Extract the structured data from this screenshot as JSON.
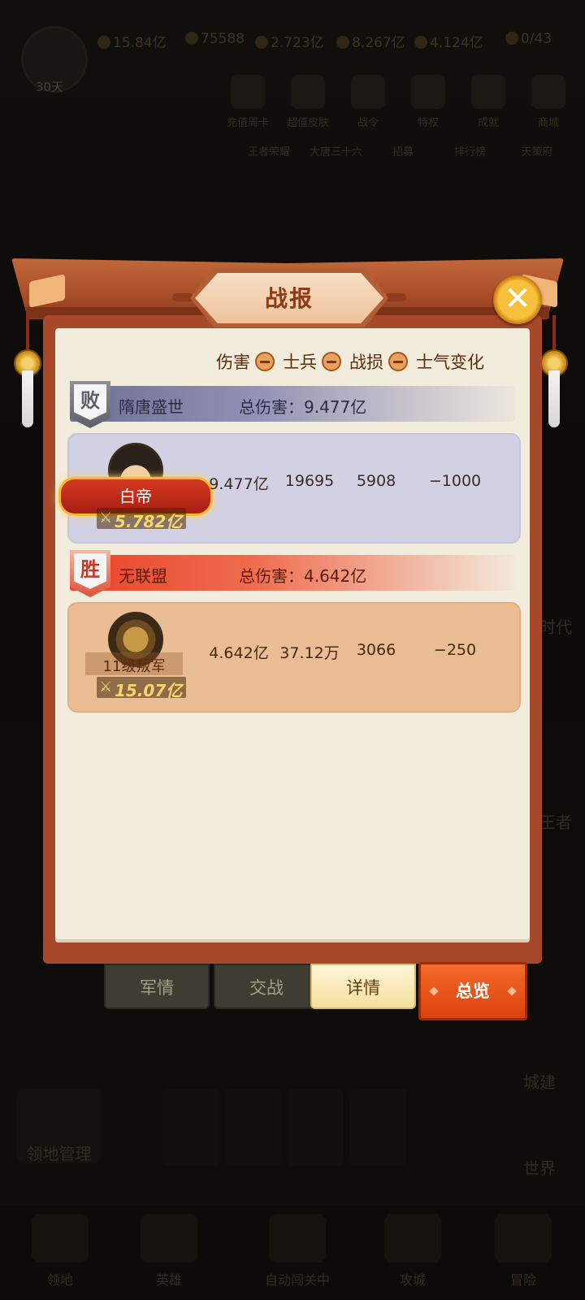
{
  "background": {
    "resources": [
      "15.84亿",
      "75588",
      "2.723亿",
      "8.267亿",
      "4.124亿",
      "0/43"
    ],
    "days": "30天",
    "top_items": [
      "充值周卡",
      "超值皮肤",
      "战令",
      "特权",
      "成就",
      "商城"
    ],
    "second_items": [
      "王者荣耀",
      "大唐三十六",
      "招募",
      "排行榜",
      "天策府"
    ],
    "side_labels": [
      "时代",
      "王者",
      "城建",
      "世界"
    ],
    "bottom_nav": [
      "领地",
      "英雄",
      "自动闯关中",
      "攻城",
      "冒险"
    ],
    "manage": "领地管理"
  },
  "dialog": {
    "title": "战报",
    "close_icon": "close-icon",
    "legend": [
      {
        "label": "伤害"
      },
      {
        "label": "士兵"
      },
      {
        "label": "战损"
      },
      {
        "label": "士气变化"
      }
    ]
  },
  "sides": [
    {
      "result_badge": "败",
      "name": "隋唐盛世",
      "total_damage": "总伤害：9.477亿",
      "unit": {
        "name": "白帝",
        "power": "5.782亿",
        "damage": "9.477亿",
        "soldiers": "19695",
        "losses": "5908",
        "morale": "−1000"
      }
    },
    {
      "result_badge": "胜",
      "name": "无联盟",
      "total_damage": "总伤害：4.642亿",
      "unit": {
        "name": "11级叛军",
        "power": "15.07亿",
        "damage": "4.642亿",
        "soldiers": "37.12万",
        "losses": "3066",
        "morale": "−250"
      }
    }
  ],
  "tabs": {
    "items": [
      "军情",
      "交战",
      "详情"
    ],
    "active": "详情",
    "overview": "总览"
  },
  "colors": {
    "panel_frame": "#a6492a",
    "panel_body": "#f2ecdd",
    "lose_row": "#d2d1e3",
    "win_row": "#ebbd95",
    "overview_button": "#e5541a"
  }
}
